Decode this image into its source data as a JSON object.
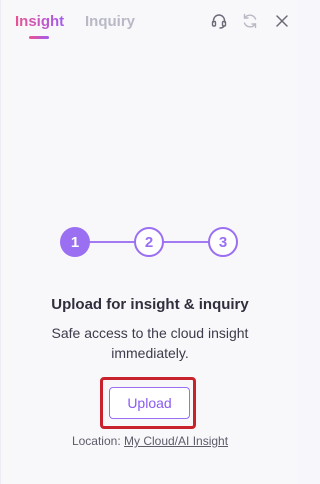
{
  "header": {
    "tabs": [
      {
        "label": "Insight",
        "active": true
      },
      {
        "label": "Inquiry",
        "active": false
      }
    ],
    "icons": [
      "headset-icon",
      "refresh-icon",
      "close-icon"
    ]
  },
  "stepper": {
    "steps": [
      "1",
      "2",
      "3"
    ],
    "current": 1,
    "accent": "#9a6ff2"
  },
  "main": {
    "title": "Upload for insight & inquiry",
    "description": "Safe access to the cloud insight immediately.",
    "upload_label": "Upload",
    "location_prefix": "Location:",
    "location_link": "My Cloud/AI Insight"
  },
  "colors": {
    "tab_gradient_start": "#e9538f",
    "tab_gradient_end": "#a35bf0",
    "highlight_border": "#c8232c"
  }
}
